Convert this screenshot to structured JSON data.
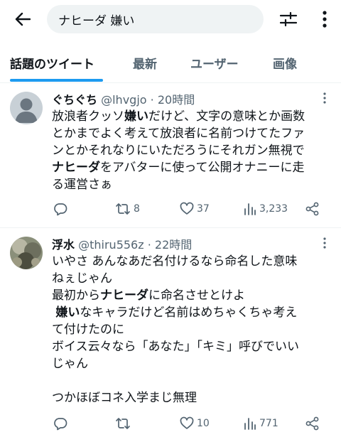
{
  "search": {
    "query": "ナヒーダ 嫌い"
  },
  "tabs": [
    {
      "label": "話題のツイート",
      "active": true
    },
    {
      "label": "最新"
    },
    {
      "label": "ユーザー"
    },
    {
      "label": "画像"
    }
  ],
  "tweets": [
    {
      "name": "ぐちぐち",
      "handle": "@lhvgjo",
      "sep": "·",
      "time": "20時間",
      "lines": [
        [
          "放浪者クッソ",
          {
            "b": "嫌い"
          },
          "だけど、文字の意味とか画数"
        ],
        [
          "とかまでよく考えて放浪者に名前つけてたファ"
        ],
        [
          "ンとかそれなりにいただろうにそれガン無視で"
        ],
        [
          {
            "b": "ナヒーダ"
          },
          "をアバターに使って公開オナニーに走"
        ],
        [
          "る運営さぁ"
        ]
      ],
      "replies": "",
      "retweets": "8",
      "likes": "37",
      "views": "3,233"
    },
    {
      "name": "浮水",
      "handle": "@thiru556z",
      "sep": "·",
      "time": "22時間",
      "lines": [
        [
          "いやさ あんなあだ名付けるなら命名した意味"
        ],
        [
          "ねぇじゃん"
        ],
        [
          "最初から",
          {
            "b": "ナヒーダ"
          },
          "に命名させとけよ"
        ],
        [
          " ",
          {
            "b": "嫌い"
          },
          "なキャラだけど名前はめちゃくちゃ考え"
        ],
        [
          "て付けたのに"
        ],
        [
          "ボイス云々なら「あなた」「キミ」呼びでいい"
        ],
        [
          "じゃん"
        ],
        [
          ""
        ],
        [
          "つかほぼコネ入学まじ無理"
        ]
      ],
      "replies": "",
      "retweets": "",
      "likes": "10",
      "views": "771"
    }
  ],
  "colors": {
    "accent": "#1d9bf0",
    "muted": "#536471",
    "text": "#0f1419"
  }
}
